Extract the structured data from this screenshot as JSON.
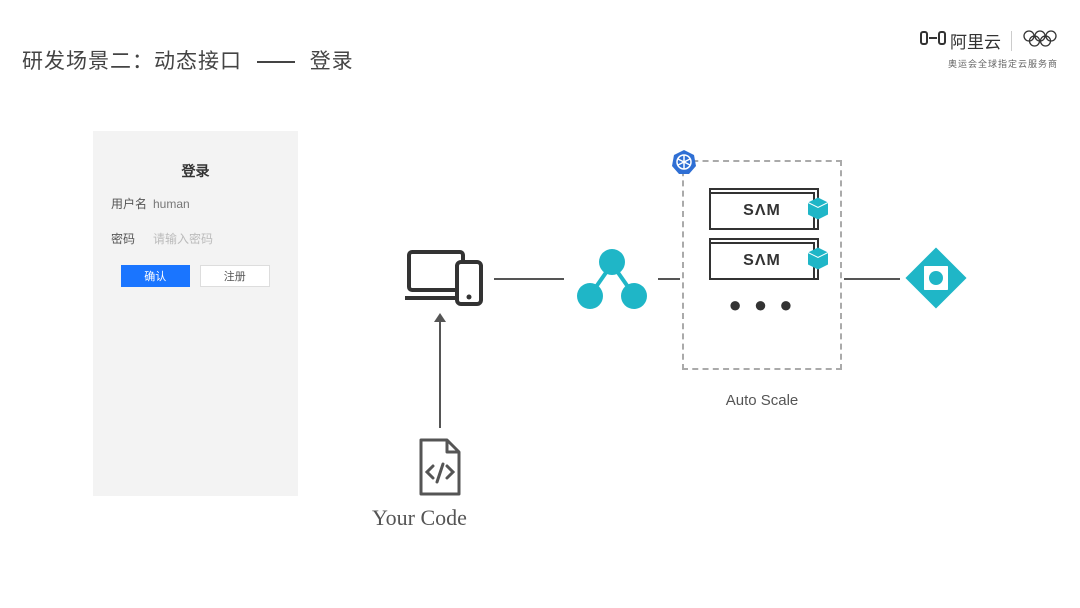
{
  "header": {
    "title_part1": "研发场景二：动态接口",
    "title_part2": "登录"
  },
  "brand": {
    "name": "阿里云",
    "subtitle": "奥运会全球指定云服务商"
  },
  "login": {
    "title": "登录",
    "username_label": "用户名",
    "username_value": "human",
    "password_label": "密码",
    "password_placeholder": "请输入密码",
    "confirm_btn": "确认",
    "register_btn": "注册"
  },
  "diagram": {
    "sam_label": "SΛM",
    "dots": "● ● ●",
    "auto_scale_label": "Auto Scale",
    "your_code_label": "Your Code"
  }
}
